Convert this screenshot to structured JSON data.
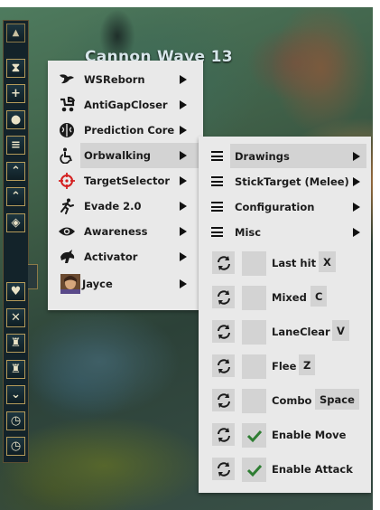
{
  "game": {
    "wave_text": "Cannon Wave 13"
  },
  "sidebar": {
    "buttons": [
      "collapse-arrow",
      "hourglass",
      "plus",
      "drop",
      "coins",
      "chevron-up",
      "lock-up",
      "diamond",
      "heart",
      "cross",
      "trophy",
      "trophy",
      "shield-down",
      "clock",
      "clock"
    ]
  },
  "main_menu": {
    "items": [
      {
        "label": "WSReborn",
        "icon": "dragon-icon"
      },
      {
        "label": "AntiGapCloser",
        "icon": "stroller-icon"
      },
      {
        "label": "Prediction Core",
        "icon": "brain-icon"
      },
      {
        "label": "Orbwalking",
        "icon": "wheelchair-icon"
      },
      {
        "label": "TargetSelector",
        "icon": "crosshair-icon"
      },
      {
        "label": "Evade 2.0",
        "icon": "running-icon"
      },
      {
        "label": "Awareness",
        "icon": "eye-icon"
      },
      {
        "label": "Activator",
        "icon": "horseman-icon"
      },
      {
        "label": "Jayce",
        "icon": "champion-portrait-icon"
      }
    ],
    "highlighted": "Orbwalking"
  },
  "orbwalking_menu": {
    "submenus": [
      "Drawings",
      "StickTarget (Melee)",
      "Configuration",
      "Misc"
    ],
    "highlighted": "Drawings",
    "keybinds": [
      {
        "label": "Last hit",
        "key": "X",
        "checked": false
      },
      {
        "label": "Mixed",
        "key": "C",
        "checked": false
      },
      {
        "label": "LaneClear",
        "key": "V",
        "checked": false
      },
      {
        "label": "Flee",
        "key": "Z",
        "checked": false
      },
      {
        "label": "Combo",
        "key": "Space",
        "checked": false
      }
    ],
    "toggles": [
      {
        "label": "Enable Move",
        "checked": true
      },
      {
        "label": "Enable Attack",
        "checked": true
      }
    ]
  },
  "colors": {
    "menu_bg": "#e9e9e9",
    "highlight": "#d3d3d3",
    "check_green": "#2e7d32",
    "target_red": "#d42020"
  }
}
